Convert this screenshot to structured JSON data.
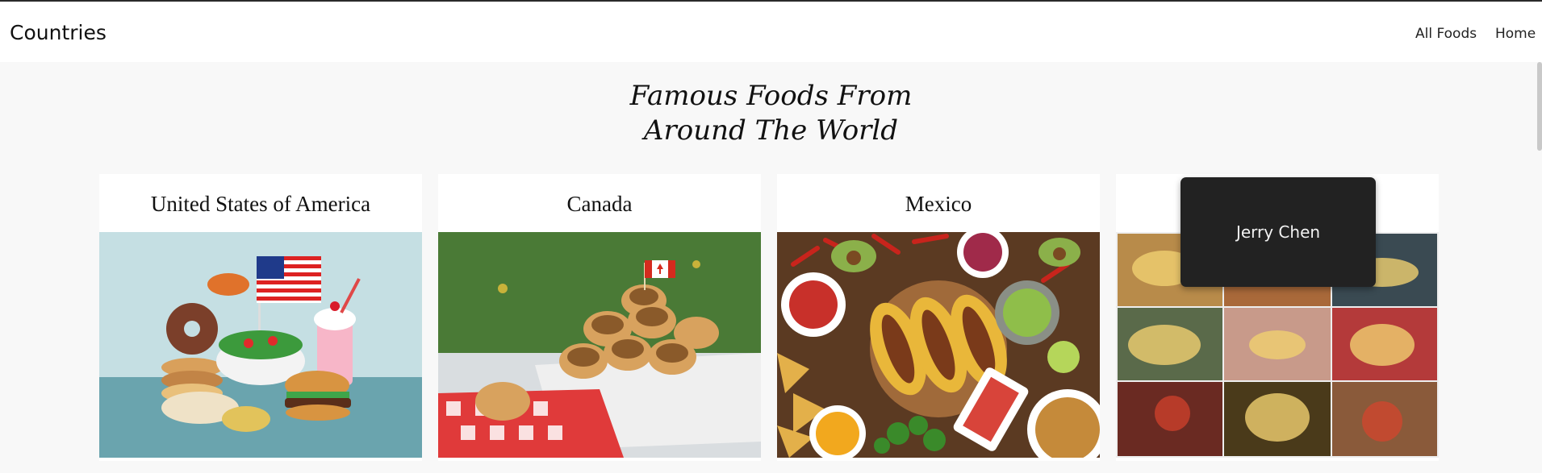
{
  "navbar": {
    "brand": "Countries",
    "links": [
      {
        "label": "All Foods"
      },
      {
        "label": "Home"
      }
    ]
  },
  "hero": {
    "title_line1": "Famous Foods From",
    "title_line2": "Around The World"
  },
  "cards": [
    {
      "title": "United States of America",
      "image_subject": "american-foods-collage"
    },
    {
      "title": "Canada",
      "image_subject": "butter-tarts-with-canadian-flag"
    },
    {
      "title": "Mexico",
      "image_subject": "tacos-and-mexican-dishes-spread"
    },
    {
      "title": "",
      "image_subject": "nine-tile-food-grid"
    }
  ],
  "tooltip": {
    "text": "Jerry Chen"
  },
  "colors": {
    "background": "#f8f8f8",
    "navbar": "#ffffff",
    "tooltip_bg": "#222222"
  }
}
